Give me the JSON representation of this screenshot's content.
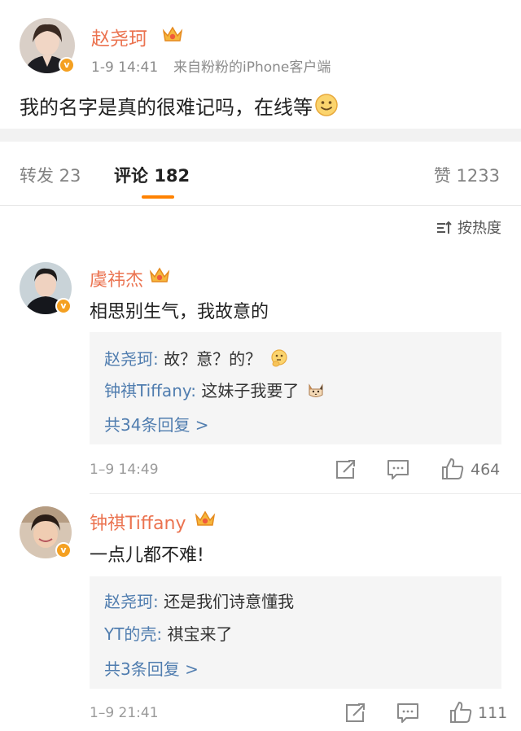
{
  "post": {
    "author": "赵尧珂",
    "time": "1-9 14:41",
    "source": "来自粉粉的iPhone客户端",
    "text": "我的名字是真的很难记吗，在线等"
  },
  "tabs": {
    "repost": "转发 23",
    "comment_label": "评论",
    "comment_count": "182",
    "like": "赞 1233"
  },
  "sort_label": "按热度",
  "comments": [
    {
      "author": "虞祎杰",
      "text": "相思别生气，我故意的",
      "replies": [
        {
          "author": "赵尧珂:",
          "text": " 故？意？的？"
        },
        {
          "author": "钟祺Tiffany:",
          "text": " 这妹子我要了"
        }
      ],
      "more": "共34条回复 >",
      "time": "1–9 14:49",
      "likes": "464"
    },
    {
      "author": "钟祺Tiffany",
      "text": "一点儿都不难!",
      "replies": [
        {
          "author": "赵尧珂:",
          "text": " 还是我们诗意懂我"
        },
        {
          "author": "YT的壳:",
          "text": " 祺宝来了"
        }
      ],
      "more": "共3条回复 >",
      "time": "1–9 21:41",
      "likes": "111"
    }
  ],
  "colors": {
    "name": "#eb7350",
    "link": "#507daf",
    "accent": "#ff8200",
    "badge": "#f4a021"
  }
}
